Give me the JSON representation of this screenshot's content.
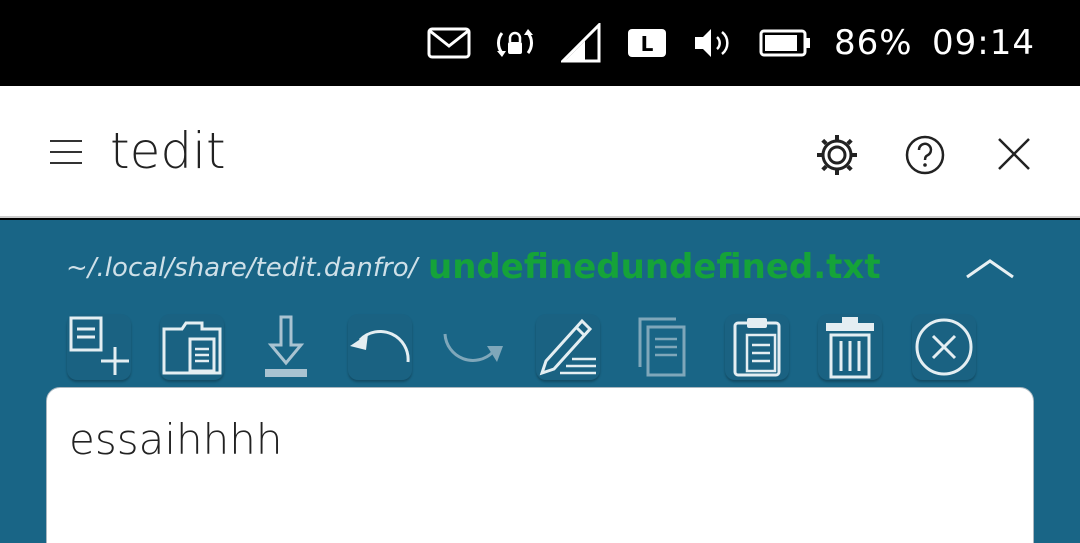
{
  "status_bar": {
    "battery_percent": "86%",
    "time": "09:14",
    "network_badge": "L",
    "icons": [
      "mail-icon",
      "rotation-lock-icon",
      "signal-icon",
      "network-type-icon",
      "volume-icon",
      "battery-icon"
    ]
  },
  "header": {
    "title": "tedit",
    "icons": [
      "menu-icon",
      "settings-icon",
      "help-icon",
      "close-icon"
    ]
  },
  "file_bar": {
    "path": "~/.local/share/tedit.danfro/",
    "filename": "undefinedundefined.txt",
    "filename_color": "#15a339"
  },
  "toolbar": {
    "tools": [
      "new-file",
      "open-file",
      "save",
      "undo",
      "redo",
      "edit",
      "copy",
      "paste",
      "delete",
      "close-file"
    ]
  },
  "editor": {
    "content": "essaihhhh"
  },
  "colors": {
    "main_background": "#196586",
    "header_background": "#ffffff",
    "status_background": "#000000"
  }
}
